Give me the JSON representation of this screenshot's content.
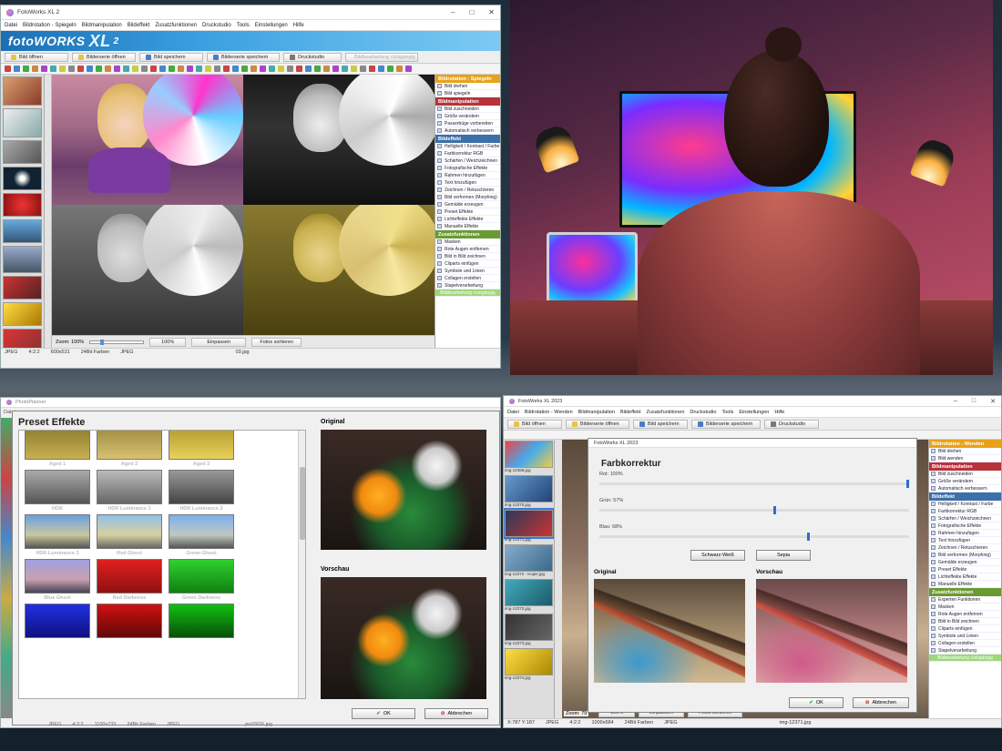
{
  "win1": {
    "title": "FotoWorks XL 2",
    "menu": [
      "Datei",
      "Bildrotation - Spiegeln",
      "Bildmanipulation",
      "Bildeffekt",
      "Zusatzfunktionen",
      "Druckstudio",
      "Tools",
      "Einstellungen",
      "Hilfe"
    ],
    "brand": {
      "foto": "fotoWORKS",
      "xl": "XL",
      "ver": "2"
    },
    "toolbar": [
      "Bild öffnen",
      "Bilderserie öffnen",
      "Bild speichern",
      "Bilderserie speichern",
      "Druckstudio",
      "Bildbearbeitung rückgängig"
    ],
    "zoom": {
      "label": "Zoom: 100%",
      "btn_100": "100%",
      "btn_fit": "Einpassen",
      "btn_sort": "Fotos sortieren",
      "value": 0.2
    },
    "status": [
      "JPEG",
      "4:2:2",
      "600x531",
      "24Bit Farben",
      "JPEG",
      "03.jpg"
    ],
    "panel": [
      {
        "h": "Bildrotation - Spiegeln",
        "c": "o",
        "items": [
          "Bild drehen",
          "Bild spiegeln"
        ]
      },
      {
        "h": "Bildmanipulation",
        "c": "r",
        "items": [
          "Bild zuschneiden",
          "Größe verändern",
          "Passerbüge vorbereiten",
          "Automatisch verbessern"
        ]
      },
      {
        "h": "Bildeffekt",
        "c": "b",
        "items": [
          "Helligkeit / Kontrast / Farbe",
          "Farbkorrektur RGB",
          "Schärfen / Weichzeichnen",
          "Fotografische Effekte",
          "Rahmen hinzufügen",
          "Text hinzufügen",
          "Zeichnen / Retuschieren",
          "Bild verformen (Morphing)",
          "Gemälde erzeugen",
          "Preset Effekte",
          "Lichteffekte Effekte",
          "Manuelle Effekte"
        ]
      },
      {
        "h": "Zusatzfunktionen",
        "c": "g",
        "items": [
          "Masken",
          "Rote Augen entfernen",
          "Bild in Bild zeichnen",
          "Cliparts einfügen",
          "Symbole und Linien",
          "Collagen erstellen",
          "Stapelverarbeitung"
        ]
      }
    ],
    "undo": "Bildbearbeitung rückgängig"
  },
  "win2": {
    "title": "PhotoPlanner",
    "menu_first": "Datei",
    "heading": "Preset Effekte",
    "original": "Original",
    "vorschau": "Vorschau",
    "presets": [
      "Aged 1",
      "Aged 2",
      "Aged 3",
      "HDR",
      "HDR Luminance 1",
      "HDR Luminance 2",
      "HDR Luminance 3",
      "Red Ghost",
      "Green Ghost",
      "Blue Ghost",
      "Red Darkness",
      "Green Darkness"
    ],
    "ok": "OK",
    "cancel": "Abbrechen",
    "status": [
      "JPEG",
      "4:2:2",
      "1100x733",
      "24Bit Farben",
      "JPEG",
      "pic09/26.jpg"
    ]
  },
  "win3": {
    "title": "FotoWorks XL 2023",
    "menu": [
      "Datei",
      "Bildrotation - Wenden",
      "Bildmanipulation",
      "Bildeffekt",
      "Zusatzfunktionen",
      "Druckstudio",
      "Tools",
      "Einstellungen",
      "Hilfe"
    ],
    "toolbar": [
      "Bild öffnen",
      "Bilderserie öffnen",
      "Bild speichern",
      "Bilderserie speichern",
      "Druckstudio"
    ],
    "thumbs": [
      "img-12369.jpg",
      "img-12370.jpg",
      "img-12371.jpg",
      "img-12372 - Kopie.jpg",
      "img-12372.jpg",
      "img-12373.jpg",
      "img-12374.jpg"
    ],
    "dialog": {
      "title": "FotoWorks XL 2023",
      "heading": "Farbkorrektur",
      "rot": "Rot: 100%",
      "gruen": "Grün: 57%",
      "blau": "Blau: 68%",
      "rot_v": 1.0,
      "gruen_v": 0.57,
      "blau_v": 0.68,
      "sw": "Schwarz-Weiß",
      "sepia": "Sepia",
      "original": "Original",
      "vorschau": "Vorschau",
      "ok": "OK",
      "cancel": "Abbrechen"
    },
    "zoom": "Zoom: 79",
    "zoom_btns": [
      "100%",
      "Einpassen",
      "Fotos sortieren"
    ],
    "panel": [
      {
        "h": "Bildrotation - Wenden",
        "c": "o",
        "items": [
          "Bild drehen",
          "Bild wenden"
        ]
      },
      {
        "h": "Bildmanipulation",
        "c": "r",
        "items": [
          "Bild zuschneiden",
          "Größe verändern",
          "Automatisch verbessern"
        ]
      },
      {
        "h": "Bildeffekt",
        "c": "b",
        "items": [
          "Helligkeit / Kontrast / Farbe",
          "Farbkorrektur RGB",
          "Schärfen / Weichzeichnen",
          "Fotografische Effekte",
          "Rahmen hinzufügen",
          "Text hinzufügen",
          "Zeichnen / Retuschieren",
          "Bild verformen (Morphing)",
          "Gemälde erzeugen",
          "Preset Effekte",
          "Lichteffekte Effekte",
          "Manuelle Effekte"
        ]
      },
      {
        "h": "Zusatzfunktionen",
        "c": "g",
        "items": [
          "Experten Funktionen",
          "Masken",
          "Rote Augen entfernen",
          "Bild in Bild zeichnen",
          "Cliparts einfügen",
          "Symbole und Linien",
          "Collagen erstellen",
          "Stapelverarbeitung"
        ]
      }
    ],
    "undo": "Bildbearbeitung rückgängig",
    "status": [
      "X:787 Y:187",
      "JPEG",
      "4:2:2",
      "1000x684",
      "24Bit Farben",
      "JPEG",
      "img-12371.jpg"
    ]
  }
}
